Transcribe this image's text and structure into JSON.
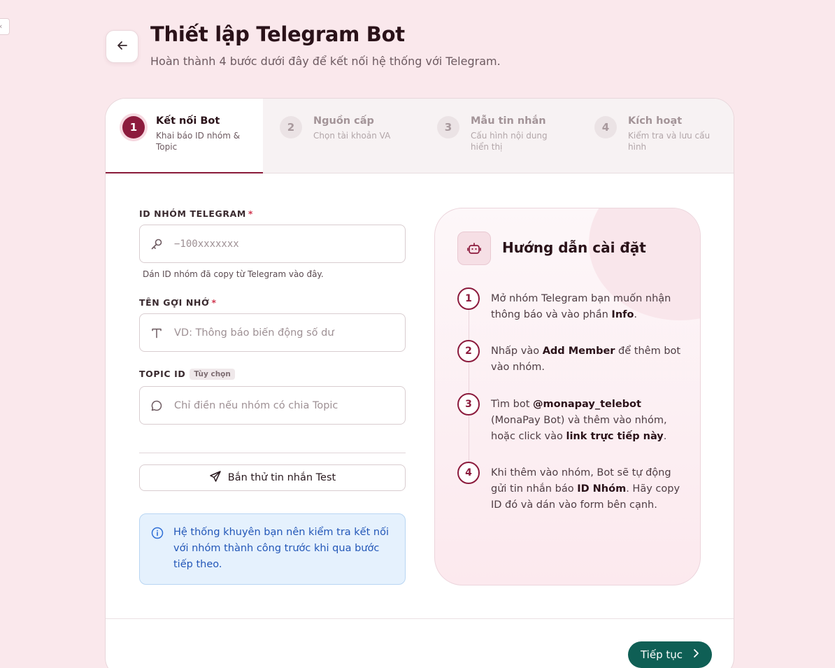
{
  "header": {
    "title": "Thiết lập Telegram Bot",
    "subtitle": "Hoàn thành 4 bước dưới đây để kết nối hệ thống với Telegram.",
    "edge_tab_glyph": "‹"
  },
  "steps": [
    {
      "num": "1",
      "title": "Kết nối Bot",
      "desc": "Khai báo ID nhóm & Topic"
    },
    {
      "num": "2",
      "title": "Nguồn cấp",
      "desc": "Chọn tài khoản VA"
    },
    {
      "num": "3",
      "title": "Mẫu tin nhắn",
      "desc": "Cấu hình nội dung hiển thị"
    },
    {
      "num": "4",
      "title": "Kích hoạt",
      "desc": "Kiểm tra và lưu cấu hình"
    }
  ],
  "form": {
    "group_id": {
      "label": "ID NHÓM TELEGRAM",
      "required": "*",
      "placeholder": "−100xxxxxxx",
      "hint": "Dán ID nhóm đã copy từ Telegram vào đây."
    },
    "nickname": {
      "label": "TÊN GỢI NHỚ",
      "required": "*",
      "placeholder": "VD: Thông báo biến động số dư"
    },
    "topic": {
      "label": "TOPIC ID",
      "optional": "Tùy chọn",
      "placeholder": "Chỉ điền nếu nhóm có chia Topic"
    },
    "test_button": "Bắn thử tin nhắn Test",
    "info": "Hệ thống khuyên bạn nên kiểm tra kết nối với nhóm thành công trước khi qua bước tiếp theo."
  },
  "guide": {
    "title": "Hướng dẫn cài đặt",
    "steps": [
      {
        "num": "1",
        "parts": [
          "Mở nhóm Telegram bạn muốn nhận thông báo và vào phần ",
          "Info",
          "."
        ]
      },
      {
        "num": "2",
        "parts": [
          "Nhấp vào ",
          "Add Member",
          " để thêm bot vào nhóm."
        ]
      },
      {
        "num": "3",
        "parts": [
          "Tìm bot ",
          "@monapay_telebot",
          " (MonaPay Bot) và thêm vào nhóm, hoặc click vào ",
          "link trực tiếp này",
          "."
        ]
      },
      {
        "num": "4",
        "parts": [
          "Khi thêm vào nhóm, Bot sẽ tự động gửi tin nhắn báo ",
          "ID Nhóm",
          ". Hãy copy ID đó và dán vào form bên cạnh."
        ]
      }
    ]
  },
  "footer": {
    "next_button": "Tiếp tục"
  },
  "colors": {
    "brand": "#8c1b3d",
    "accent_green": "#0f5f55",
    "info_blue": "#2357b8"
  },
  "icons": {
    "back": "arrow-left-icon",
    "key": "key-icon",
    "text": "text-icon",
    "chat": "chat-bubble-icon",
    "send": "send-icon",
    "info": "info-circle-icon",
    "bot": "robot-icon",
    "next": "chevron-right-icon"
  }
}
